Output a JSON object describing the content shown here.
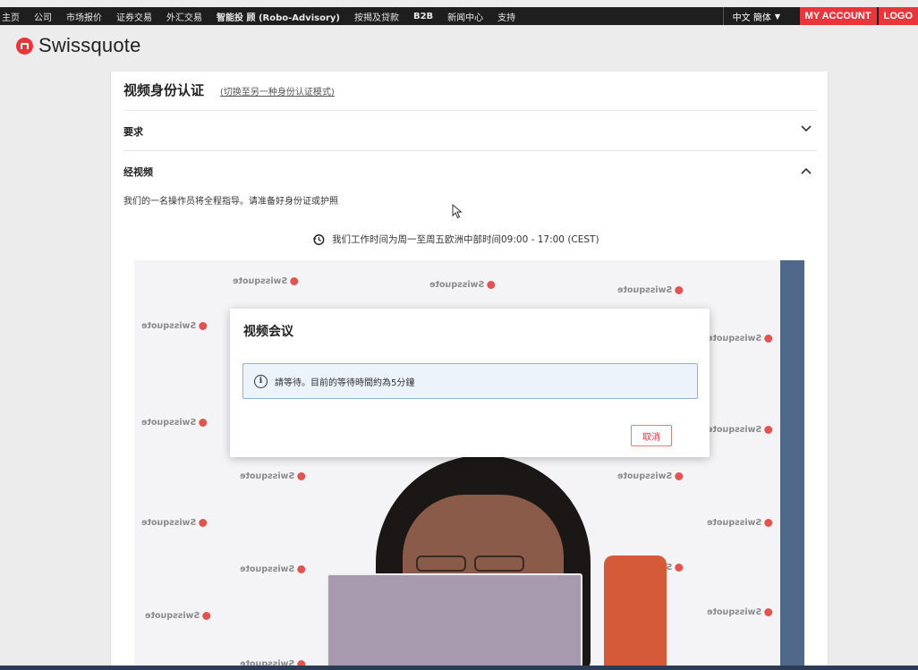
{
  "topnav": {
    "items": [
      "主页",
      "公司",
      "市场报价",
      "证券交易",
      "外汇交易",
      "智能投 顾 (Robo-Advisory)",
      "按揭及贷款",
      "B2B",
      "新闻中心",
      "支持"
    ],
    "language": "中文 簡体",
    "my_account": "MY ACCOUNT",
    "logout": "LOGO"
  },
  "logo": {
    "text": "Swissquote",
    "icon": "swissquote-logo-icon"
  },
  "page": {
    "title": "视频身份认证",
    "switch_link": "(切换至另一种身份认证模式)"
  },
  "sections": {
    "requirements": {
      "title": "要求",
      "icon": "chevron-down-icon"
    },
    "via_video": {
      "title": "经视频",
      "icon": "chevron-up-icon",
      "description": "我们的一名操作员将全程指导。请准备好身份证或护照",
      "hours": "我们工作时间为周一至周五欧洲中部时间09:00 - 17:00 (CEST)"
    }
  },
  "video": {
    "wall_logo_text": "Swissquote"
  },
  "modal": {
    "title": "视频会议",
    "info_text": "請等待。目前的等待時間約為5分鐘",
    "cancel_label": "取消"
  },
  "colors": {
    "brand_red": "#e9363d",
    "nav_bg": "#1e1e1e",
    "info_bg": "#edf3fb",
    "info_border": "#8fb2dc"
  }
}
